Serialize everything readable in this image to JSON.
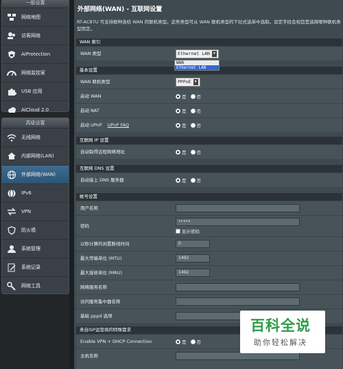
{
  "sidebar": {
    "top_group": {
      "title": "一般设置",
      "items": [
        {
          "label": "网络地图",
          "icon": "network-map-icon"
        },
        {
          "label": "访客网络",
          "icon": "guest-network-icon"
        },
        {
          "label": "AiProtection",
          "icon": "shield-lock-icon"
        },
        {
          "label": "网络监控家",
          "icon": "gauge-icon"
        },
        {
          "label": "USB 应用",
          "icon": "puzzle-icon"
        },
        {
          "label": "AiCloud 2.0",
          "icon": "cloud-icon"
        }
      ]
    },
    "advanced_group": {
      "title": "高级设置",
      "items": [
        {
          "label": "无线网络",
          "icon": "wifi-icon"
        },
        {
          "label": "内部网络(LAN)",
          "icon": "home-icon"
        },
        {
          "label": "外部网络(WAN)",
          "icon": "globe-icon",
          "active": true
        },
        {
          "label": "IPv6",
          "icon": "ipv6-globe-icon"
        },
        {
          "label": "VPN",
          "icon": "vpn-arrows-icon"
        },
        {
          "label": "防火墙",
          "icon": "firewall-shield-icon"
        },
        {
          "label": "系统管理",
          "icon": "admin-user-icon"
        },
        {
          "label": "系统记录",
          "icon": "log-pencil-icon"
        },
        {
          "label": "网络工具",
          "icon": "tools-wrench-icon"
        }
      ]
    }
  },
  "page": {
    "title": "外部网络(WAN) - 互联网设置",
    "description": "RT-AC87U 可支持数种连结 WAN 的联机类型。这些类型可从 WAN 联机类型的下拉式选单中选取。设定字段会视您是选择哪种联机类型而定。"
  },
  "wan_index": {
    "section": "WAN 索引",
    "wan_type_label": "WAN 类型",
    "wan_type_value": "Ethernet LAN",
    "dropdown_options": [
      "WAN",
      "Ethernet LAN"
    ]
  },
  "basic": {
    "section": "基本设置",
    "conn_type_label": "WAN 联机类型",
    "conn_type_value": "PPPoE",
    "enable_wan_label": "启动 WAN",
    "enable_nat_label": "启动 NAT",
    "enable_upnp_label": "启动 UPnP",
    "upnp_faq": "UPnP  FAQ",
    "yes": "是",
    "no": "否"
  },
  "ip_setting": {
    "section": "互联网 IP 设置",
    "auto_ip_label": "自动取得远程网络地址"
  },
  "dns_setting": {
    "section": "互联网 DNS 设置",
    "auto_dns_label": "自动接上 DNS 服务器"
  },
  "account": {
    "section": "帐号设置",
    "username_label": "用户名称",
    "username_value": "",
    "password_label": "密码",
    "password_value": "•••••",
    "show_password_label": "显示密码",
    "idle_label": "以秒计算的闲置断线时间",
    "idle_value": "0",
    "mtu_label": "最大传输单位 (MTU)",
    "mtu_value": "1492",
    "mru_label": "最大接收单位 (MRU)",
    "mru_value": "1492",
    "service_label": "网络服务名称",
    "concentrator_label": "访问服务集中器名称",
    "pppd_label": "基础 pppd 选项"
  },
  "isp": {
    "section": "来自ISP运营商的特殊需求",
    "vpn_dhcp_label": "Enable VPN + DHCP Connection",
    "hostname_label": "主机名称"
  },
  "watermark": {
    "title": "百科全说",
    "subtitle": "助你轻松解决"
  }
}
